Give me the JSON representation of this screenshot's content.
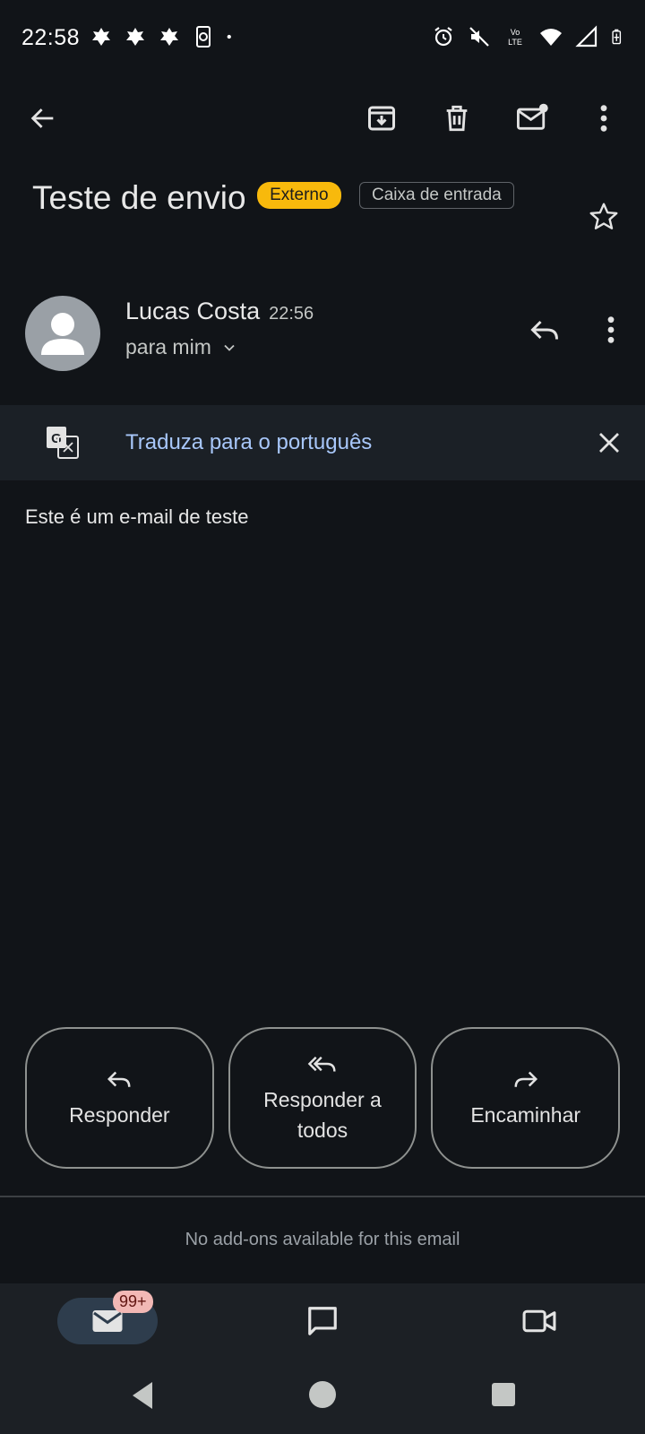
{
  "status_bar": {
    "time": "22:58",
    "left_icons": [
      "notification-icon",
      "notification-icon",
      "notification-icon",
      "phone-sync-icon",
      "dot-icon"
    ],
    "right_icons": [
      "alarm-icon",
      "mute-icon",
      "volte-icon",
      "wifi-icon",
      "signal-icon",
      "battery-icon"
    ],
    "volte_label": "Vo LTE"
  },
  "app_bar": {
    "icons": [
      "back-arrow-icon",
      "archive-icon",
      "delete-icon",
      "mark-unread-icon",
      "more-vert-icon"
    ]
  },
  "email": {
    "subject": "Teste de envio",
    "external_label": "Externo",
    "folder_label": "Caixa de entrada",
    "sender_name": "Lucas Costa",
    "time": "22:56",
    "recipient": "para mim",
    "body": "Este é um e-mail de teste"
  },
  "translate": {
    "label": "Traduza para o português"
  },
  "actions": {
    "reply": "Responder",
    "reply_all": "Responder a todos",
    "forward": "Encaminhar"
  },
  "addons": {
    "message": "No add-ons available for this email"
  },
  "bottom_nav": {
    "mail_badge": "99+",
    "items": [
      "mail-icon",
      "chat-icon",
      "meet-icon"
    ]
  },
  "colors": {
    "background": "#111418",
    "external_chip": "#f8b90c",
    "link": "#a8c7fa",
    "badge": "#f2b8b5"
  }
}
